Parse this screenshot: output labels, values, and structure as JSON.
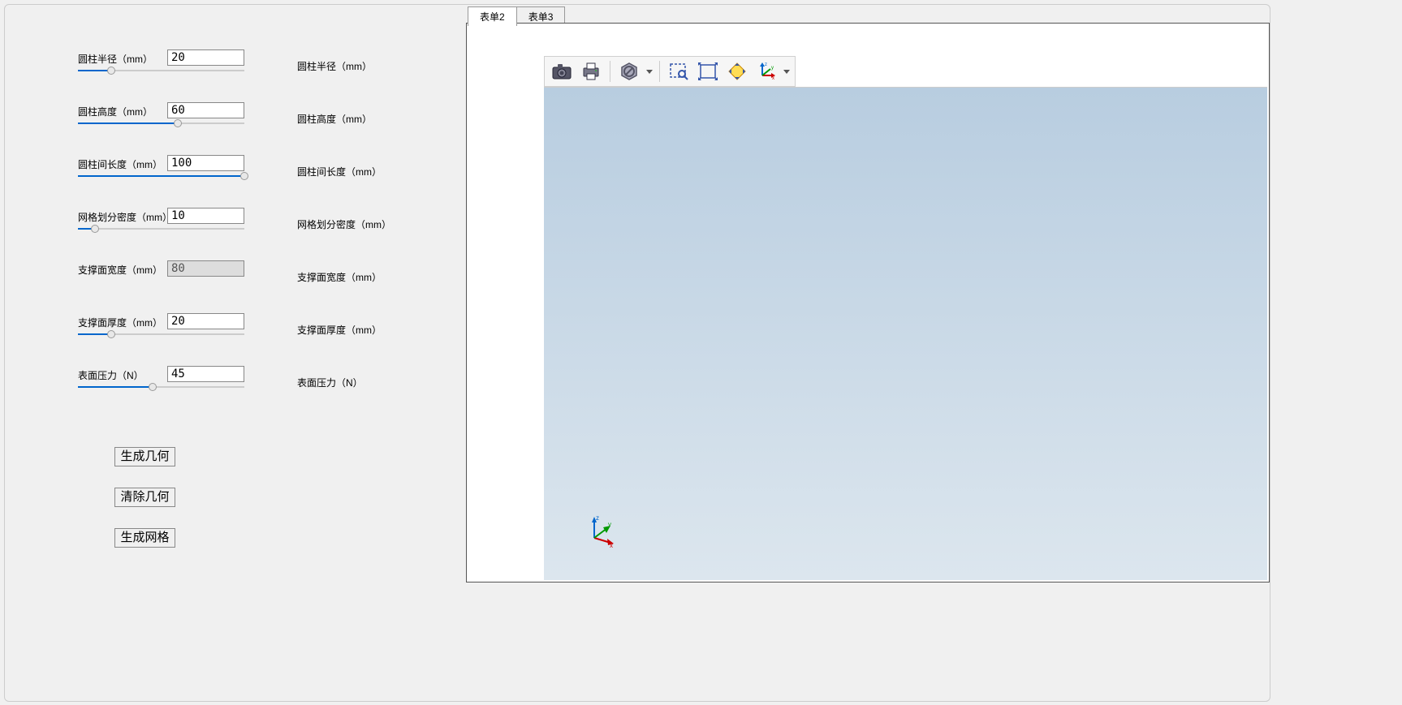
{
  "params": [
    {
      "label": "圆柱半径（mm）",
      "value": "20",
      "slider_pct": 20,
      "disabled": false
    },
    {
      "label": "圆柱高度（mm）",
      "value": "60",
      "slider_pct": 60,
      "disabled": false
    },
    {
      "label": "圆柱间长度（mm）",
      "value": "100",
      "slider_pct": 100,
      "disabled": false
    },
    {
      "label": "网格划分密度（mm）",
      "value": "10",
      "slider_pct": 10,
      "disabled": false
    },
    {
      "label": "支撑面宽度（mm）",
      "value": "80",
      "slider_pct": 0,
      "disabled": true
    },
    {
      "label": "支撑面厚度（mm）",
      "value": "20",
      "slider_pct": 20,
      "disabled": false
    },
    {
      "label": "表面压力（N）",
      "value": "45",
      "slider_pct": 45,
      "disabled": false
    }
  ],
  "right_labels": [
    "圆柱半径（mm）",
    "圆柱高度（mm）",
    "圆柱间长度（mm）",
    "网格划分密度（mm）",
    "支撑面宽度（mm）",
    "支撑面厚度（mm）",
    "表面压力（N）"
  ],
  "buttons": {
    "generate_geometry": "生成几何",
    "clear_geometry": "清除几何",
    "generate_mesh": "生成网格"
  },
  "tabs": [
    {
      "label": "表单2",
      "active": true
    },
    {
      "label": "表单3",
      "active": false
    }
  ],
  "toolbar_icons": [
    "camera-icon",
    "print-icon",
    "sep",
    "block-icon",
    "dropdown",
    "sep",
    "zoom-select-icon",
    "zoom-extents-icon",
    "zoom-fit-icon",
    "triad-icon",
    "dropdown"
  ],
  "triad": {
    "x": "x",
    "y": "y",
    "z": "z"
  }
}
